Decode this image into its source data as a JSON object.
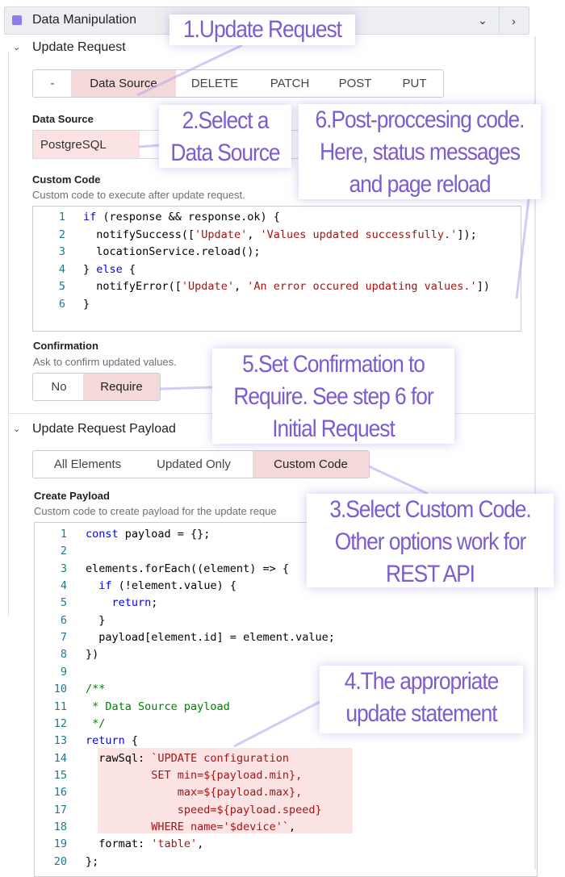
{
  "header": {
    "title": "Data Manipulation",
    "icon": "grid-icon"
  },
  "update_request": {
    "title": "Update Request",
    "methods": [
      "-",
      "Data Source",
      "DELETE",
      "PATCH",
      "POST",
      "PUT"
    ],
    "selected_method": "Data Source",
    "data_source_label": "Data Source",
    "data_source_value": "PostgreSQL",
    "custom_code_label": "Custom Code",
    "custom_code_desc": "Custom code to execute after update request.",
    "code": [
      [
        [
          "kw",
          "if"
        ],
        [
          "tx",
          " (response && response.ok) {"
        ]
      ],
      [
        [
          "tx",
          "  notifySuccess(["
        ],
        [
          "str",
          "'Update'"
        ],
        [
          "tx",
          ", "
        ],
        [
          "str",
          "'Values updated successfully.'"
        ],
        [
          "tx",
          "]);"
        ]
      ],
      [
        [
          "tx",
          "  locationService.reload();"
        ]
      ],
      [
        [
          "tx",
          "} "
        ],
        [
          "kw",
          "else"
        ],
        [
          "tx",
          " {"
        ]
      ],
      [
        [
          "tx",
          "  notifyError(["
        ],
        [
          "str",
          "'Update'"
        ],
        [
          "tx",
          ", "
        ],
        [
          "str",
          "'An error occured updating values.'"
        ],
        [
          "tx",
          "])"
        ]
      ],
      [
        [
          "tx",
          "}"
        ]
      ]
    ],
    "confirmation_label": "Confirmation",
    "confirmation_desc": "Ask to confirm updated values.",
    "confirmation_options": [
      "No",
      "Require"
    ],
    "confirmation_selected": "Require"
  },
  "payload": {
    "title": "Update Request Payload",
    "options": [
      "All Elements",
      "Updated Only",
      "Custom Code"
    ],
    "selected": "Custom Code",
    "create_label": "Create Payload",
    "create_desc": "Custom code to create payload for the update reque",
    "code": [
      [
        [
          "kw",
          "const"
        ],
        [
          "tx",
          " payload = {};"
        ]
      ],
      [],
      [
        [
          "tx",
          "elements.forEach((element) => {"
        ]
      ],
      [
        [
          "tx",
          "  "
        ],
        [
          "kw",
          "if"
        ],
        [
          "tx",
          " (!element.value) {"
        ]
      ],
      [
        [
          "tx",
          "    "
        ],
        [
          "kw",
          "return"
        ],
        [
          "tx",
          ";"
        ]
      ],
      [
        [
          "tx",
          "  }"
        ]
      ],
      [
        [
          "tx",
          "  payload[element.id] = element.value;"
        ]
      ],
      [
        [
          "tx",
          "})"
        ]
      ],
      [],
      [
        [
          "cm",
          "/**"
        ]
      ],
      [
        [
          "cm",
          " * Data Source payload"
        ]
      ],
      [
        [
          "cm",
          " */"
        ]
      ],
      [
        [
          "kw",
          "return"
        ],
        [
          "tx",
          " {"
        ]
      ],
      [
        [
          "tx",
          "  rawSql: "
        ],
        [
          "str",
          "`UPDATE configuration"
        ]
      ],
      [
        [
          "str",
          "          SET min=${payload.min},"
        ]
      ],
      [
        [
          "str",
          "              max=${payload.max},"
        ]
      ],
      [
        [
          "str",
          "              speed=${payload.speed}"
        ]
      ],
      [
        [
          "str",
          "          WHERE name='$device'`"
        ],
        [
          "tx",
          ","
        ]
      ],
      [
        [
          "tx",
          "  format: "
        ],
        [
          "str",
          "'table'"
        ],
        [
          "tx",
          ","
        ]
      ],
      [
        [
          "tx",
          "};"
        ]
      ]
    ]
  },
  "annotations": {
    "a1": "1.Update Request",
    "a2": [
      "2.Select a",
      "Data Source"
    ],
    "a6": [
      "6.Post-proccesing code.",
      "Here, status messages",
      "and page reload"
    ],
    "a5": [
      "5.Set Confirmation to",
      "Require. See step 6 for",
      "Initial Request"
    ],
    "a3": [
      "3.Select Custom Code.",
      "Other options work for",
      "REST API"
    ],
    "a4": [
      "4.The appropriate",
      "update statement"
    ]
  },
  "colors": {
    "accent": "#7d5bd0",
    "highlight": "#f5d9da"
  }
}
